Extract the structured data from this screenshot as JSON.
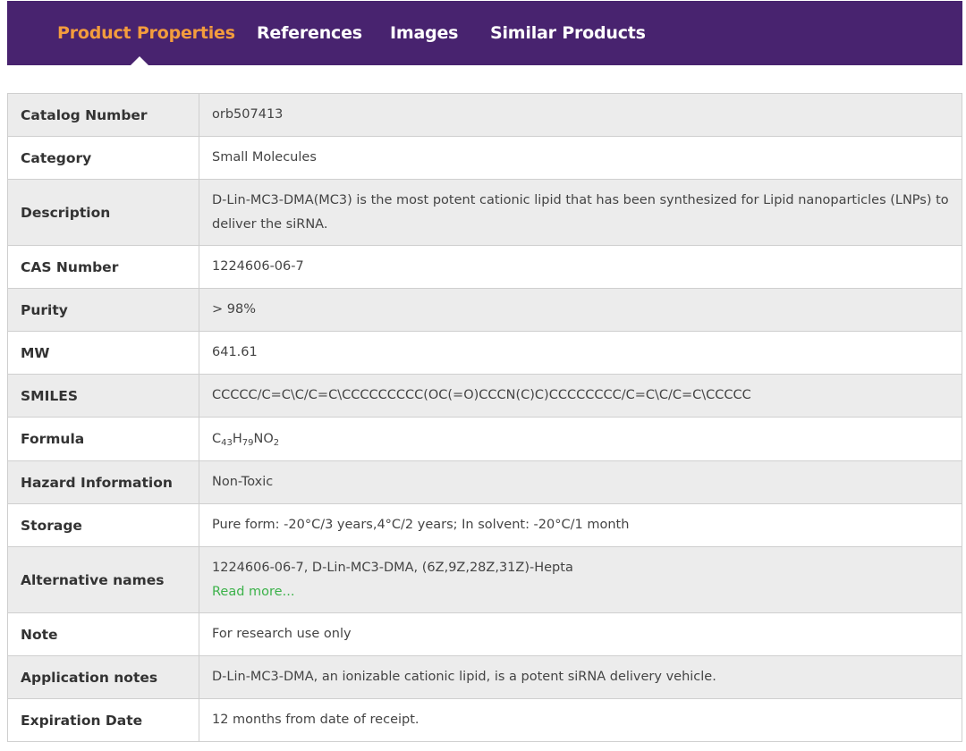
{
  "tabs": [
    {
      "label": "Product Properties",
      "active": true
    },
    {
      "label": "References"
    },
    {
      "label": "Images"
    },
    {
      "label": "Similar Products"
    }
  ],
  "colors": {
    "header_bg": "#48236f",
    "active_tab": "#f39c3d",
    "link": "#3cb24a",
    "row_alt": "#ececec"
  },
  "rows": {
    "catalog": {
      "label": "Catalog Number",
      "value": "orb507413"
    },
    "category": {
      "label": "Category",
      "value": "Small Molecules"
    },
    "description": {
      "label": "Description",
      "value": "D-Lin-MC3-DMA(MC3) is the most potent cationic lipid that has been synthesized for Lipid nanoparticles (LNPs) to deliver the siRNA."
    },
    "cas": {
      "label": "CAS Number",
      "value": "1224606-06-7"
    },
    "purity": {
      "label": "Purity",
      "value": "> 98%"
    },
    "mw": {
      "label": "MW",
      "value": "641.61"
    },
    "smiles": {
      "label": "SMILES",
      "value": "CCCCC/C=C\\C/C=C\\CCCCCCCCC(OC(=O)CCCN(C)C)CCCCCCCC/C=C\\C/C=C\\CCCCC"
    },
    "formula": {
      "label": "Formula",
      "parts": [
        "C",
        "43",
        "H",
        "79",
        "NO",
        "2"
      ]
    },
    "hazard": {
      "label": "Hazard Information",
      "value": "Non-Toxic"
    },
    "storage": {
      "label": "Storage",
      "value": "Pure form: -20°C/3 years,4°C/2 years; In solvent: -20°C/1 month"
    },
    "altnames": {
      "label": "Alternative names",
      "value": "1224606-06-7, D-Lin-MC3-DMA, (6Z,9Z,28Z,31Z)-Hepta",
      "link": "Read more..."
    },
    "note": {
      "label": "Note",
      "value": "For research use only"
    },
    "appnotes": {
      "label": "Application notes",
      "value": "D-Lin-MC3-DMA, an ionizable cationic lipid, is a potent siRNA delivery vehicle."
    },
    "expiry": {
      "label": "Expiration Date",
      "value": "12 months from date of receipt."
    }
  }
}
